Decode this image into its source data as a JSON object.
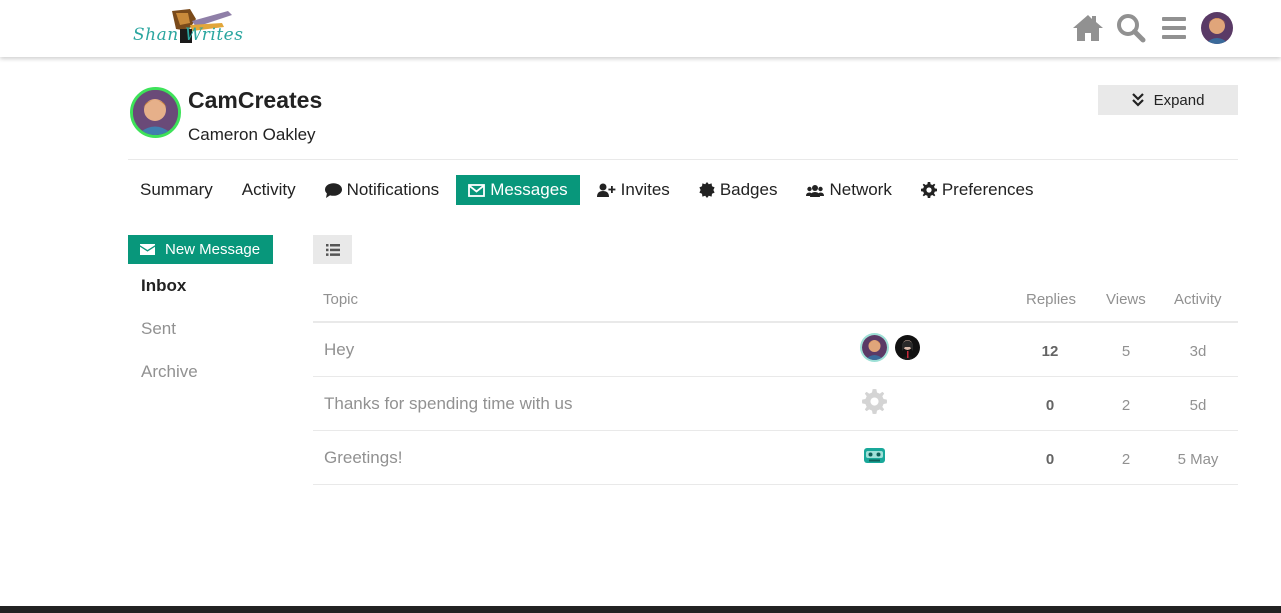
{
  "site": {
    "logo_text": "Shan Writes"
  },
  "header": {
    "icons": [
      "home-icon",
      "search-icon",
      "hamburger-menu-icon",
      "user-avatar"
    ]
  },
  "profile": {
    "username": "CamCreates",
    "full_name": "Cameron Oakley",
    "expand_label": "Expand"
  },
  "nav": {
    "tabs": [
      {
        "label": "Summary",
        "icon": ""
      },
      {
        "label": "Activity",
        "icon": ""
      },
      {
        "label": "Notifications",
        "icon": "comment-icon"
      },
      {
        "label": "Messages",
        "icon": "envelope-icon",
        "active": true
      },
      {
        "label": "Invites",
        "icon": "user-plus-icon"
      },
      {
        "label": "Badges",
        "icon": "certificate-icon"
      },
      {
        "label": "Network",
        "icon": "users-icon"
      },
      {
        "label": "Preferences",
        "icon": "gear-icon"
      }
    ]
  },
  "sidebar": {
    "new_message_label": "New Message",
    "folders": [
      {
        "label": "Inbox",
        "active": true
      },
      {
        "label": "Sent"
      },
      {
        "label": "Archive"
      }
    ]
  },
  "table": {
    "headers": {
      "topic": "Topic",
      "replies": "Replies",
      "views": "Views",
      "activity": "Activity"
    },
    "rows": [
      {
        "title": "Hey",
        "replies": "12",
        "views": "5",
        "activity": "3d",
        "posters": [
          "cam-avatar",
          "dark-avatar"
        ]
      },
      {
        "title": "Thanks for spending time with us",
        "replies": "0",
        "views": "2",
        "activity": "5d",
        "posters": [
          "system-gear-avatar"
        ]
      },
      {
        "title": "Greetings!",
        "replies": "0",
        "views": "2",
        "activity": "5 May",
        "posters": [
          "bot-avatar"
        ]
      }
    ]
  },
  "colors": {
    "accent": "#08977b",
    "muted_text": "#919191",
    "online_ring": "#3ee25a"
  }
}
